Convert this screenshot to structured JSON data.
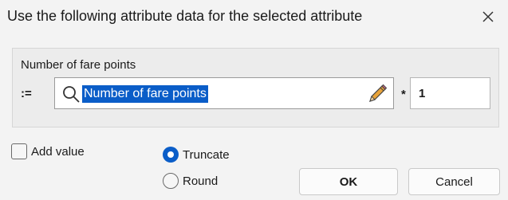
{
  "dialog": {
    "title": "Use the following attribute data for the selected attribute",
    "close_icon": "close-icon"
  },
  "group": {
    "label": "Number of fare points",
    "assign_operator": ":=",
    "expression": "Number of fare points",
    "search_icon": "search-icon",
    "edit_icon": "pencil-icon",
    "multiply_operator": "*",
    "factor_value": "1"
  },
  "options": {
    "add_value": {
      "label": "Add value",
      "checked": false
    },
    "rounding": [
      {
        "label": "Truncate",
        "selected": true
      },
      {
        "label": "Round",
        "selected": false
      }
    ]
  },
  "buttons": {
    "ok_label": "OK",
    "cancel_label": "Cancel"
  },
  "colors": {
    "accent": "#0a5dc8",
    "background": "#f3f3f3"
  }
}
